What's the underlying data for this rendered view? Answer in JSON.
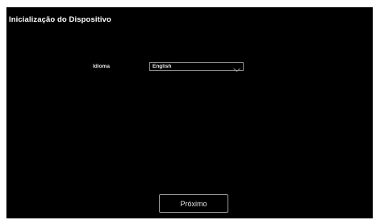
{
  "dialog": {
    "title": "Inicialização do Dispositivo"
  },
  "language": {
    "label": "Idioma",
    "selected_value": "English",
    "icon": "chevron-down-icon"
  },
  "actions": {
    "next_label": "Próximo"
  },
  "colors": {
    "background": "#000000",
    "text": "#ffffff",
    "border": "#8a8a8a"
  }
}
